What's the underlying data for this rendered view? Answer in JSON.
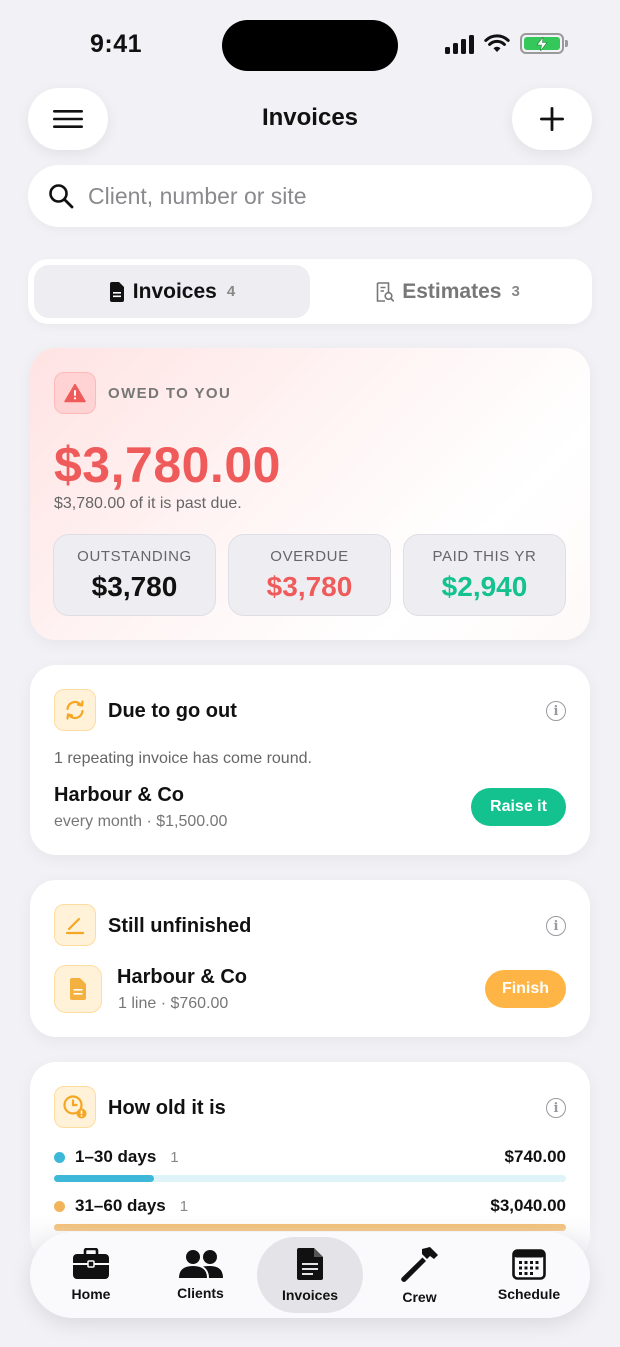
{
  "status_bar": {
    "time": "9:41"
  },
  "header": {
    "title": "Invoices"
  },
  "search": {
    "placeholder": "Client, number or site"
  },
  "segments": [
    {
      "label": "Invoices",
      "count": "4",
      "active": true,
      "icon": "document-icon"
    },
    {
      "label": "Estimates",
      "count": "3",
      "active": false,
      "icon": "receipt-icon"
    }
  ],
  "owed": {
    "label": "OWED TO YOU",
    "amount": "$3,780.00",
    "subtitle": "$3,780.00 of it is past due.",
    "stats": [
      {
        "label": "OUTSTANDING",
        "value": "$3,780",
        "color": "#111111"
      },
      {
        "label": "OVERDUE",
        "value": "$3,780",
        "color": "#ef5b5b"
      },
      {
        "label": "PAID THIS YR",
        "value": "$2,940",
        "color": "#14c28f"
      }
    ]
  },
  "due_out": {
    "title": "Due to go out",
    "note": "1 repeating invoice has come round.",
    "client": "Harbour & Co",
    "detail": "every month · $1,500.00",
    "button": "Raise it"
  },
  "unfinished": {
    "title": "Still unfinished",
    "client": "Harbour & Co",
    "detail": "1 line · $760.00",
    "button": "Finish"
  },
  "aging": {
    "title": "How old it is",
    "buckets": [
      {
        "label": "1–30 days",
        "count": "1",
        "amount": "$740.00",
        "fraction": 0.196,
        "color": "#3db8d8",
        "track": "#dff4f8"
      },
      {
        "label": "31–60 days",
        "count": "1",
        "amount": "$3,040.00",
        "fraction": 1.0,
        "color": "#f2b45a",
        "track": "#fbebd2"
      }
    ]
  },
  "tabbar": [
    {
      "label": "Home",
      "icon": "briefcase-icon",
      "active": false
    },
    {
      "label": "Clients",
      "icon": "people-icon",
      "active": false
    },
    {
      "label": "Invoices",
      "icon": "invoice-icon",
      "active": true
    },
    {
      "label": "Crew",
      "icon": "hammer-icon",
      "active": false
    },
    {
      "label": "Schedule",
      "icon": "calendar-icon",
      "active": false
    }
  ],
  "colors": {
    "accent_green": "#14c28f",
    "accent_orange": "#ffb545",
    "danger": "#ef5b5b"
  }
}
